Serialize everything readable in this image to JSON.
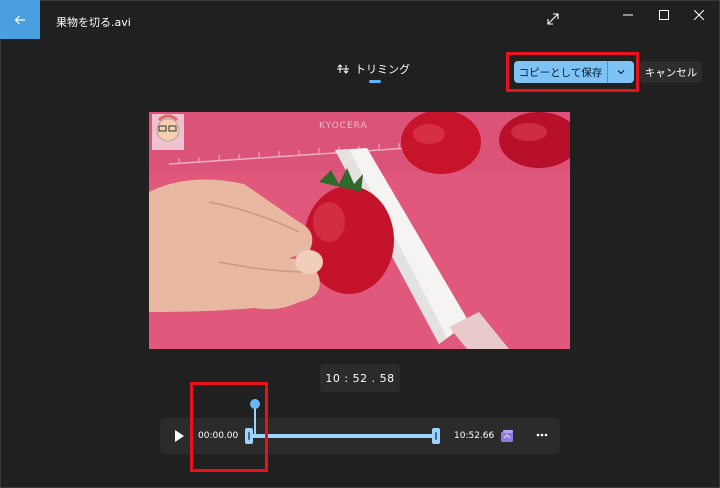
{
  "titlebar": {
    "title": "果物を切る.avi",
    "icons": [
      "back-arrow-icon",
      "expand-icon",
      "minimize-icon",
      "maximize-icon",
      "close-icon"
    ]
  },
  "toolbar": {
    "tab_label": "トリミング",
    "tab_icon": "trim-icon",
    "save_label": "コピーとして保存",
    "cancel_label": "キャンセル"
  },
  "video": {
    "logo_text": "KYOCERA"
  },
  "player": {
    "timecode": "10 : 52 . 58",
    "start_time": "00:00.00",
    "end_time": "10:52.66",
    "playhead_position": 0.02
  },
  "colors": {
    "accent": "#7ec3f5",
    "background": "#202020",
    "panel": "#2b2b2b",
    "highlight": "#e8121a"
  }
}
